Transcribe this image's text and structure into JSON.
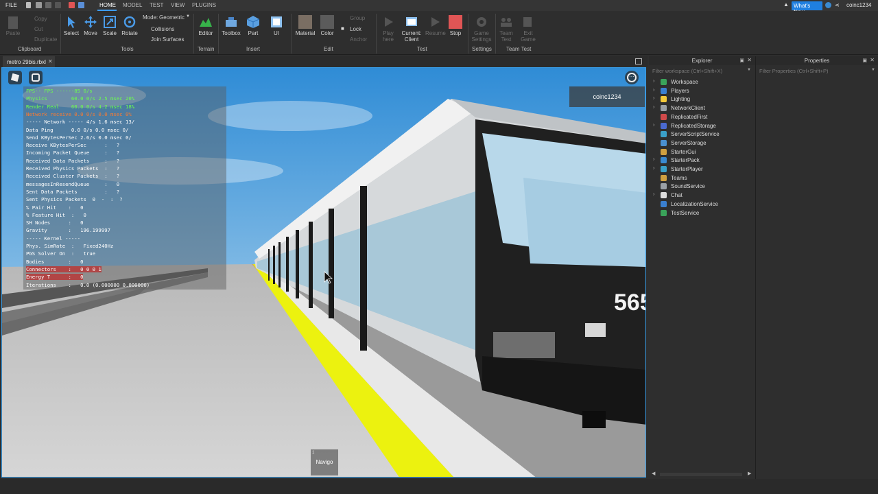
{
  "topbar": {
    "file_label": "FILE",
    "tabs": [
      "HOME",
      "MODEL",
      "TEST",
      "VIEW",
      "PLUGINS"
    ],
    "whats_new": "What's New",
    "username": "coinc1234"
  },
  "ribbon": {
    "clipboard": {
      "paste": "Paste",
      "copy": "Copy",
      "cut": "Cut",
      "duplicate": "Duplicate",
      "group": "Clipboard"
    },
    "tools": {
      "select": "Select",
      "move": "Move",
      "scale": "Scale",
      "rotate": "Rotate",
      "group": "Tools",
      "mode_label": "Mode:",
      "mode_value": "Geometric",
      "collisions": "Collisions",
      "join_surfaces": "Join Surfaces"
    },
    "terrain": {
      "editor": "Editor",
      "group": "Terrain"
    },
    "insert": {
      "toolbox": "Toolbox",
      "part": "Part",
      "ui": "UI",
      "group": "Insert"
    },
    "edit": {
      "material": "Material",
      "color": "Color",
      "group_btn": "Group",
      "lock": "Lock",
      "anchor": "Anchor",
      "group": "Edit"
    },
    "test": {
      "play": "Play here",
      "current": "Current: Client",
      "resume": "Resume",
      "stop": "Stop",
      "group": "Test"
    },
    "settings": {
      "game_settings": "Game Settings",
      "group": "Settings"
    },
    "team_test": {
      "team_test": "Team Test",
      "exit_game": "Exit Game",
      "group": "Team Test"
    }
  },
  "document": {
    "tab_title": "metro 29bis.rbxl"
  },
  "viewport": {
    "username_tag": "coinc1234",
    "bottom_button": "Navigo",
    "bottom_button_number": "1",
    "train_number": "565",
    "stats": [
      "FPS-- FPS ------85 0/s",
      "Physics        60.0 0/s 2.5 msec 20%",
      "Render Real    60.0 0/s 4.2 msec 18%",
      "Network receive 0.0 0/s 0.0 msec 0%",
      "----- Network ----- 4/s 1.6 msec 13/",
      "Data Ping      0.0 0/s 0.0 msec 0/",
      "Send KBytesPerSec 2.6/s 0.0 msec 0/",
      "Receive KBytesPerSec      :   ?",
      "Incoming Packet Queue     :   ?",
      "Received Data Packets     :   ?",
      "Received Physics Packets  :   ?",
      "Received Cluster Packets  :   ?",
      "messagesInResendQueue     :   0",
      "Sent Data Packets         :   ?",
      "Sent Physics Packets  0  -  :  ?",
      "% Pair Hit    :   0",
      "% Feature Hit  :   0",
      "SH Nodes      :   0",
      "Gravity       :   196.199997",
      "----- Kernel -----",
      "Phys. SimRate  :   Fixed240Hz",
      "PGS Solver On  :   true",
      "Bodies        :   0",
      "Connectors    :   0 0 0 1",
      "Energy T      :   0",
      "Iterations    :   0.0 (0.000000 0.000000)"
    ]
  },
  "explorer": {
    "title": "Explorer",
    "filter_placeholder": "Filter workspace (Ctrl+Shift+X)",
    "items": [
      {
        "label": "Workspace",
        "icon": "globe-icon",
        "color": "#3aa35a",
        "arrow": true
      },
      {
        "label": "Players",
        "icon": "players-icon",
        "color": "#3a7fd0",
        "arrow": true
      },
      {
        "label": "Lighting",
        "icon": "lightbulb-icon",
        "color": "#f3c93a",
        "arrow": true
      },
      {
        "label": "NetworkClient",
        "icon": "network-icon",
        "color": "#9aa0a6",
        "arrow": true
      },
      {
        "label": "ReplicatedFirst",
        "icon": "replicated-icon",
        "color": "#d04a4a",
        "arrow": false
      },
      {
        "label": "ReplicatedStorage",
        "icon": "storage-icon",
        "color": "#4a6ad0",
        "arrow": true
      },
      {
        "label": "ServerScriptService",
        "icon": "script-service-icon",
        "color": "#3aa0c8",
        "arrow": false
      },
      {
        "label": "ServerStorage",
        "icon": "server-storage-icon",
        "color": "#4a90d0",
        "arrow": false
      },
      {
        "label": "StarterGui",
        "icon": "gui-icon",
        "color": "#d0a040",
        "arrow": false
      },
      {
        "label": "StarterPack",
        "icon": "pack-icon",
        "color": "#3a8ad0",
        "arrow": true
      },
      {
        "label": "StarterPlayer",
        "icon": "player-icon",
        "color": "#3aa0c8",
        "arrow": true
      },
      {
        "label": "Teams",
        "icon": "teams-icon",
        "color": "#d0a040",
        "arrow": false
      },
      {
        "label": "SoundService",
        "icon": "sound-icon",
        "color": "#9aa0a6",
        "arrow": false
      },
      {
        "label": "Chat",
        "icon": "chat-icon",
        "color": "#dcdcdc",
        "arrow": true
      },
      {
        "label": "LocalizationService",
        "icon": "localization-icon",
        "color": "#3a7fd0",
        "arrow": false
      },
      {
        "label": "TestService",
        "icon": "test-icon",
        "color": "#3aa35a",
        "arrow": false
      }
    ]
  },
  "properties": {
    "title": "Properties",
    "filter_placeholder": "Filter Properties (Ctrl+Shift+P)"
  }
}
